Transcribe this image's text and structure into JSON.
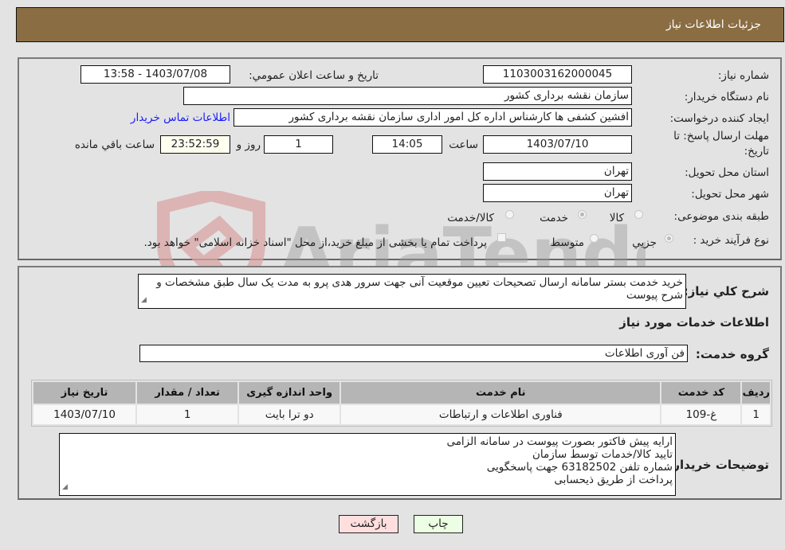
{
  "header": {
    "title": "جزئیات اطلاعات نیاز"
  },
  "form": {
    "need_number": {
      "label": "شماره نیاز:",
      "value": "1103003162000045"
    },
    "announce_datetime": {
      "label": "تاریخ و ساعت اعلان عمومي:",
      "value": "1403/07/08 - 13:58"
    },
    "buyer_org": {
      "label": "نام دستگاه خریدار:",
      "value": "سازمان نقشه برداری کشور"
    },
    "requester": {
      "label": "ایجاد کننده درخواست:",
      "value": "افشین کشفی ها کارشناس اداره کل امور اداری سازمان نقشه برداری کشور"
    },
    "buyer_contact_link": "اطلاعات تماس خریدار",
    "deadline": {
      "label_line1": "مهلت ارسال پاسخ: تا",
      "label_line2": "تاریخ:",
      "date": "1403/07/10",
      "time_label": "ساعت",
      "time": "14:05",
      "days": "1",
      "days_label": "روز و",
      "remaining": "23:52:59",
      "remaining_label": "ساعت باقي مانده"
    },
    "province": {
      "label": "استان محل تحویل:",
      "value": "تهران"
    },
    "city": {
      "label": "شهر محل تحویل:",
      "value": "تهران"
    },
    "category": {
      "label": "طبقه بندی موضوعی:",
      "options": [
        {
          "label": "کالا",
          "checked": false
        },
        {
          "label": "خدمت",
          "checked": true
        },
        {
          "label": "کالا/خدمت",
          "checked": false
        }
      ]
    },
    "purchase_type": {
      "label": "نوع فرآیند خرید :",
      "options": [
        {
          "label": "جزيي",
          "checked": true
        },
        {
          "label": "متوسط",
          "checked": false
        }
      ],
      "treasury_checkbox_label": "پرداخت تمام یا بخشی از مبلغ خرید،از محل \"اسناد خزانه اسلامی\" خواهد بود.",
      "treasury_checked": false
    }
  },
  "description": {
    "label": "شرح کلي نیاز:",
    "value": "خرید خدمت بستر سامانه ارسال تصحیحات تعیین موقعیت آنی جهت سرور هدی پرو به مدت یک سال طبق مشخصات و شرح پیوست"
  },
  "services_section": {
    "title": "اطلاعات خدمات مورد نیاز",
    "group_label": "گروه خدمت:",
    "group_value": "فن آوری اطلاعات"
  },
  "table": {
    "columns": [
      "ردیف",
      "کد خدمت",
      "نام خدمت",
      "واحد اندازه گیری",
      "تعداد / مقدار",
      "تاریخ نیاز"
    ],
    "rows": [
      [
        "1",
        "غ-109",
        "فناوری اطلاعات و ارتباطات",
        "دو ترا بایت",
        "1",
        "1403/07/10"
      ]
    ]
  },
  "buyer_notes": {
    "label": "توضیحات خریدار:",
    "lines": [
      "ارایه پیش فاکتور بصورت پیوست در سامانه الزامی",
      "تایید کالا/خدمات  توسط سازمان",
      "شماره تلفن 63182502 جهت پاسخگویی",
      "پرداخت از طریق ذیحسابی"
    ]
  },
  "buttons": {
    "print": "چاپ",
    "back": "بازگشت"
  },
  "watermark": {
    "text": "AriaTender.neT"
  },
  "colors": {
    "header_bg": "#8b6d43",
    "link": "#1a1aff",
    "back_btn": "#ffdede",
    "print_btn": "#ecffe4"
  }
}
